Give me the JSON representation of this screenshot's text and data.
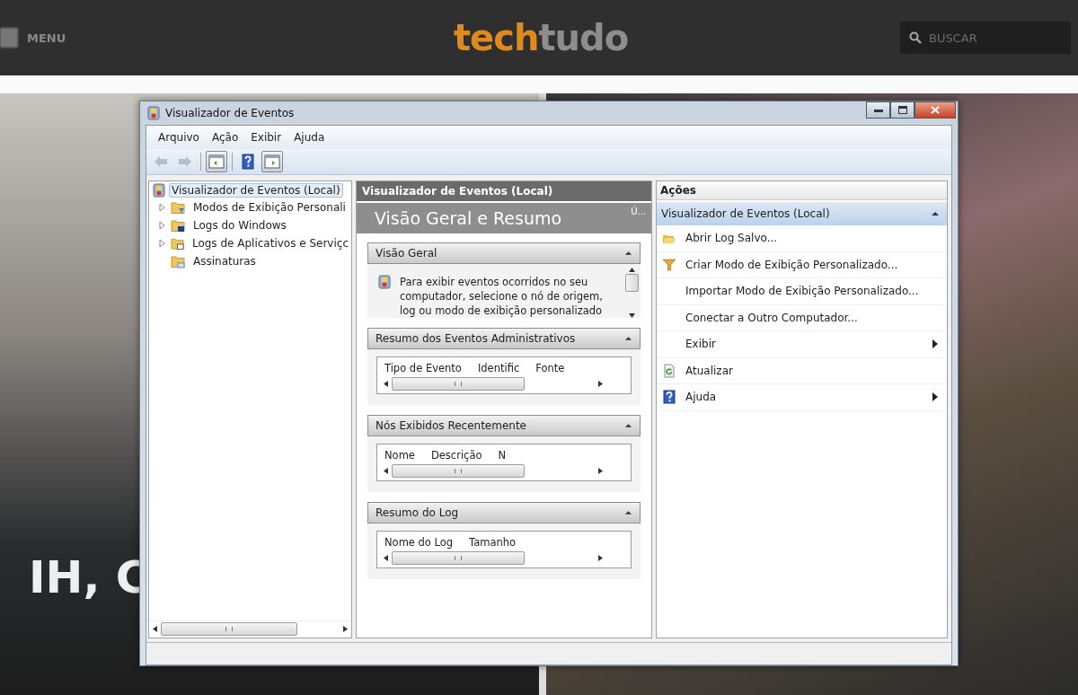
{
  "site": {
    "menu_label": "MENU",
    "logo_first": "tech",
    "logo_second": "tudo",
    "search_placeholder": "BUSCAR",
    "headline": "IH, C"
  },
  "window": {
    "title": "Visualizador de Eventos"
  },
  "menu": [
    "Arquivo",
    "Ação",
    "Exibir",
    "Ajuda"
  ],
  "toolbar": [
    {
      "kind": "back",
      "disabled": true
    },
    {
      "kind": "forward",
      "disabled": true
    },
    {
      "kind": "pane-left",
      "disabled": false
    },
    {
      "kind": "help",
      "disabled": false
    },
    {
      "kind": "pane-right",
      "disabled": false
    }
  ],
  "tree": {
    "label": "Visualizador de Eventos (Local)",
    "selected": true,
    "children": [
      {
        "label": "Modos de Exibição Personali",
        "selected": false,
        "expandable": true,
        "kind": "filter-folder"
      },
      {
        "label": "Logs do Windows",
        "selected": false,
        "expandable": true,
        "kind": "log-folder"
      },
      {
        "label": "Logs de Aplicativos e Serviçc",
        "selected": false,
        "expandable": true,
        "kind": "app-folder"
      },
      {
        "label": "Assinaturas",
        "selected": false,
        "expandable": false,
        "kind": "sub-folder"
      }
    ]
  },
  "center": {
    "header": "Visualizador de Eventos (Local)",
    "title": "Visão Geral e Resumo",
    "corner": "Ú...",
    "sections": [
      {
        "title": "Visão Geral",
        "expanded": true,
        "kind": "text",
        "text": "Para exibir eventos ocorridos no seu computador, selecione o nó de origem, log ou modo de exibição personalizado"
      },
      {
        "title": "Resumo dos Eventos Administrativos",
        "expanded": true,
        "kind": "table",
        "columns": [
          "Tipo de Evento",
          "Identific",
          "Fonte"
        ]
      },
      {
        "title": "Nós Exibidos Recentemente",
        "expanded": true,
        "kind": "table",
        "columns": [
          "Nome",
          "Descrição",
          "N"
        ]
      },
      {
        "title": "Resumo do Log",
        "expanded": true,
        "kind": "table",
        "columns": [
          "Nome do Log",
          "Tamanho"
        ]
      }
    ]
  },
  "actions": {
    "title": "Ações",
    "group": {
      "title": "Visualizador de Eventos (Local)",
      "expanded": true
    },
    "items": [
      {
        "label": "Abrir Log Salvo...",
        "kind": "open",
        "submenu": false
      },
      {
        "label": "Criar Modo de Exibição Personalizado...",
        "kind": "filter",
        "submenu": false
      },
      {
        "label": "Importar Modo de Exibição Personalizado...",
        "kind": "plain",
        "submenu": false
      },
      {
        "label": "Conectar a Outro Computador...",
        "kind": "plain",
        "submenu": false
      },
      {
        "label": "Exibir",
        "kind": "plain",
        "submenu": true
      },
      {
        "label": "Atualizar",
        "kind": "refresh",
        "submenu": false
      },
      {
        "label": "Ajuda",
        "kind": "help",
        "submenu": true
      }
    ]
  }
}
